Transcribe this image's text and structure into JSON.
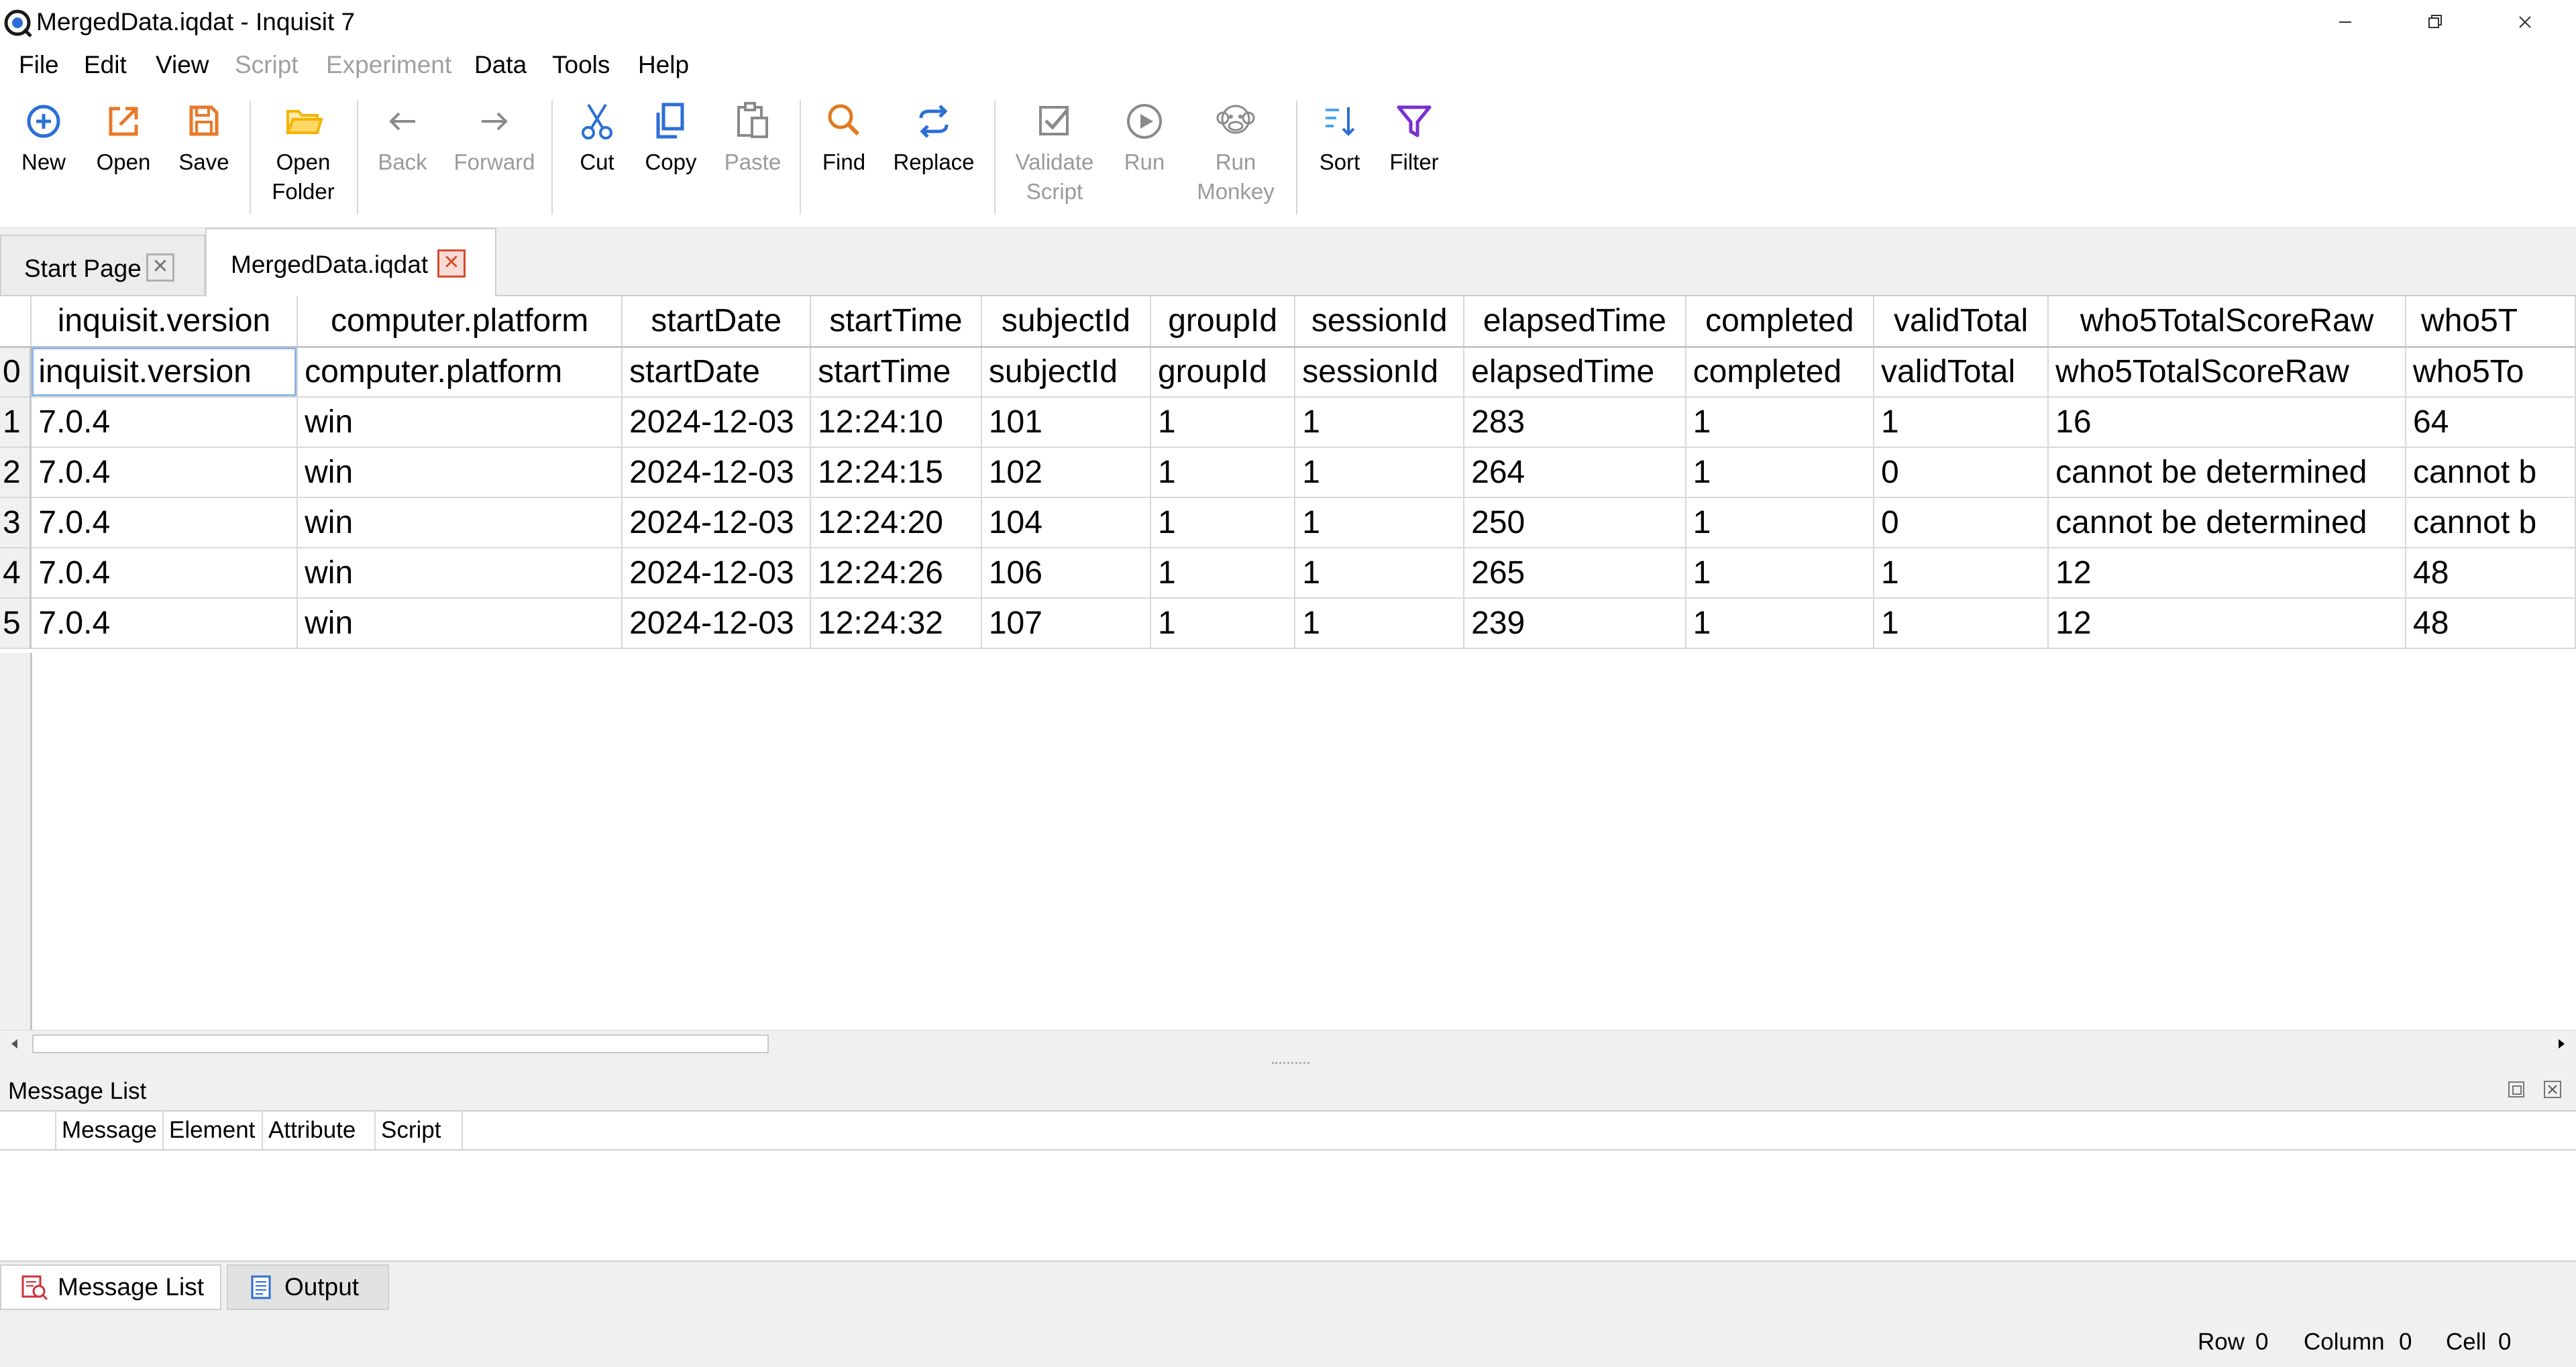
{
  "window": {
    "title": "MergedData.iqdat - Inquisit 7",
    "minimize_symbol": "—",
    "maximize_symbol": "❐",
    "close_symbol": "✕"
  },
  "menu": [
    {
      "label": "File",
      "enabled": true
    },
    {
      "label": "Edit",
      "enabled": true
    },
    {
      "label": "View",
      "enabled": true
    },
    {
      "label": "Script",
      "enabled": false
    },
    {
      "label": "Experiment",
      "enabled": false
    },
    {
      "label": "Data",
      "enabled": true
    },
    {
      "label": "Tools",
      "enabled": true
    },
    {
      "label": "Help",
      "enabled": true
    }
  ],
  "toolbar": {
    "new": "New",
    "open": "Open",
    "save": "Save",
    "open_folder_1": "Open",
    "open_folder_2": "Folder",
    "back": "Back",
    "forward": "Forward",
    "cut": "Cut",
    "copy": "Copy",
    "paste": "Paste",
    "find": "Find",
    "replace": "Replace",
    "validate_1": "Validate",
    "validate_2": "Script",
    "run": "Run",
    "run_monkey_1": "Run",
    "run_monkey_2": "Monkey",
    "sort": "Sort",
    "filter": "Filter"
  },
  "tabs": [
    {
      "label": "Start Page",
      "active": false
    },
    {
      "label": "MergedData.iqdat",
      "active": true
    }
  ],
  "grid": {
    "headers": [
      "inquisit.version",
      "computer.platform",
      "startDate",
      "startTime",
      "subjectId",
      "groupId",
      "sessionId",
      "elapsedTime",
      "completed",
      "validTotal",
      "who5TotalScoreRaw",
      "who5T"
    ],
    "rows": [
      [
        "0",
        "inquisit.version",
        "computer.platform",
        "startDate",
        "startTime",
        "subjectId",
        "groupId",
        "sessionId",
        "elapsedTime",
        "completed",
        "validTotal",
        "who5TotalScoreRaw",
        "who5To"
      ],
      [
        "1",
        "7.0.4",
        "win",
        "2024-12-03",
        "12:24:10",
        "101",
        "1",
        "1",
        "283",
        "1",
        "1",
        "16",
        "64"
      ],
      [
        "2",
        "7.0.4",
        "win",
        "2024-12-03",
        "12:24:15",
        "102",
        "1",
        "1",
        "264",
        "1",
        "0",
        "cannot be determined",
        "cannot b"
      ],
      [
        "3",
        "7.0.4",
        "win",
        "2024-12-03",
        "12:24:20",
        "104",
        "1",
        "1",
        "250",
        "1",
        "0",
        "cannot be determined",
        "cannot b"
      ],
      [
        "4",
        "7.0.4",
        "win",
        "2024-12-03",
        "12:24:26",
        "106",
        "1",
        "1",
        "265",
        "1",
        "1",
        "12",
        "48"
      ],
      [
        "5",
        "7.0.4",
        "win",
        "2024-12-03",
        "12:24:32",
        "107",
        "1",
        "1",
        "239",
        "1",
        "1",
        "12",
        "48"
      ]
    ]
  },
  "message_list": {
    "title": "Message List",
    "columns": [
      "Message",
      "Element",
      "Attribute",
      "Script"
    ]
  },
  "bottom_tabs": [
    {
      "label": "Message List",
      "active": true
    },
    {
      "label": "Output",
      "active": false
    }
  ],
  "status": {
    "row_label": "Row",
    "row_value": "0",
    "column_label": "Column",
    "column_value": "0",
    "cell_label": "Cell",
    "cell_value": "0"
  },
  "colors": {
    "accent_blue": "#2b6fd6",
    "orange": "#e8792a",
    "folder_yellow": "#f5b301",
    "find_orange": "#e07a1f",
    "filter_purple": "#7a2fd1",
    "close_red": "#d84a2e"
  }
}
